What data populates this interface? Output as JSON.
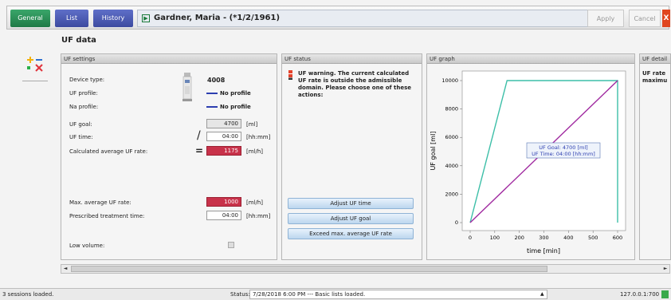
{
  "tabs": {
    "general": "General",
    "list": "List",
    "history": "History"
  },
  "patient": {
    "name": "Gardner, Maria - (*1/2/1961)"
  },
  "toolbar": {
    "apply": "Apply",
    "cancel": "Cancel",
    "close": "X"
  },
  "section": {
    "title": "UF data"
  },
  "uf_settings": {
    "header": "UF settings",
    "device_type_label": "Device type:",
    "device_type_value": "4008",
    "uf_profile_label": "UF profile:",
    "uf_profile_value": "No profile",
    "na_profile_label": "Na profile:",
    "na_profile_value": "No profile",
    "uf_goal_label": "UF goal:",
    "uf_goal_value": "4700",
    "uf_goal_unit": "[ml]",
    "uf_time_label": "UF time:",
    "uf_time_symbol": "/",
    "uf_time_value": "04:00",
    "uf_time_unit": "[hh:mm]",
    "calc_rate_label": "Calculated average UF rate:",
    "calc_rate_symbol": "=",
    "calc_rate_value": "1175",
    "calc_rate_unit": "[ml/h]",
    "max_rate_label": "Max. average UF rate:",
    "max_rate_value": "1000",
    "max_rate_unit": "[ml/h]",
    "treatment_time_label": "Prescribed treatment time:",
    "treatment_time_value": "04:00",
    "treatment_time_unit": "[hh:mm]",
    "low_volume_label": "Low volume:"
  },
  "uf_status": {
    "header": "UF status",
    "warning": "UF warning. The current calculated UF rate is outside the admissible domain. Please choose one of these actions:",
    "btn_adjust_time": "Adjust UF time",
    "btn_adjust_goal": "Adjust UF goal",
    "btn_exceed_rate": "Exceed max. average UF rate"
  },
  "uf_graph": {
    "header": "UF graph",
    "tooltip_line1": "UF Goal: 4700 [ml]",
    "tooltip_line2": "UF Time: 04:00 [hh:mm]"
  },
  "chart_data": {
    "type": "line",
    "xlabel": "time [min]",
    "ylabel": "UF goal [ml]",
    "xlim": [
      0,
      600
    ],
    "ylim": [
      0,
      10000
    ],
    "x_ticks": [
      0,
      100,
      200,
      300,
      400,
      500,
      600
    ],
    "y_ticks": [
      0,
      2000,
      4000,
      6000,
      8000,
      10000
    ],
    "series": [
      {
        "color": "#3dbfa8",
        "x": [
          0,
          150,
          600,
          600
        ],
        "y": [
          0,
          10000,
          10000,
          0
        ]
      },
      {
        "color": "#a02aa0",
        "x": [
          0,
          600
        ],
        "y": [
          0,
          10000
        ]
      }
    ],
    "marker": {
      "x": 240,
      "y": 4700,
      "color": "#1d1f8c"
    }
  },
  "uf_detail": {
    "header": "UF detail",
    "text1": "UF rate",
    "text2": "maximu"
  },
  "scrollbar": {
    "left": "◄",
    "right": "►"
  },
  "statusbar": {
    "sessions": "3 sessions loaded.",
    "status_label": "Status:",
    "status_text": "7/28/2018 6:00 PM --- Basic lists loaded.",
    "status_arrow": "▲",
    "address": "127.0.0.1:700"
  },
  "colors": {
    "accent_green": "#1f7a47",
    "warning_red": "#c8324a",
    "tab_blue": "#3c4aa0"
  }
}
